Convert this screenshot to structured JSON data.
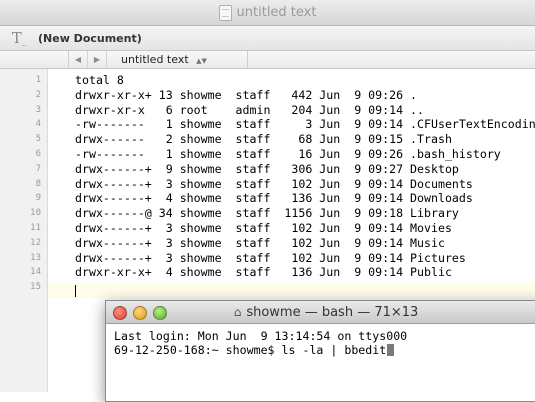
{
  "window": {
    "title": "untitled text"
  },
  "toolbar": {
    "document_name": "(New Document)"
  },
  "nav": {
    "prev_glyph": "◀",
    "next_glyph": "▶",
    "current_document": "untitled text",
    "doc_menu_glyph": "▲▼"
  },
  "editor": {
    "lines": [
      "total 8",
      "drwxr-xr-x+ 13 showme  staff   442 Jun  9 09:26 .",
      "drwxr-xr-x   6 root    admin   204 Jun  9 09:14 ..",
      "-rw-------   1 showme  staff     3 Jun  9 09:14 .CFUserTextEncoding",
      "drwx------   2 showme  staff    68 Jun  9 09:15 .Trash",
      "-rw-------   1 showme  staff    16 Jun  9 09:26 .bash_history",
      "drwx------+  9 showme  staff   306 Jun  9 09:27 Desktop",
      "drwx------+  3 showme  staff   102 Jun  9 09:14 Documents",
      "drwx------+  4 showme  staff   136 Jun  9 09:14 Downloads",
      "drwx------@ 34 showme  staff  1156 Jun  9 09:18 Library",
      "drwx------+  3 showme  staff   102 Jun  9 09:14 Movies",
      "drwx------+  3 showme  staff   102 Jun  9 09:14 Music",
      "drwx------+  3 showme  staff   102 Jun  9 09:14 Pictures",
      "drwxr-xr-x+  4 showme  staff   136 Jun  9 09:14 Public",
      ""
    ],
    "line_numbers": [
      "1",
      "2",
      "3",
      "4",
      "5",
      "6",
      "7",
      "8",
      "9",
      "10",
      "11",
      "12",
      "13",
      "14",
      "15"
    ]
  },
  "terminal": {
    "title": "showme — bash — 71×13",
    "line1": "Last login: Mon Jun  9 13:14:54 on ttys000",
    "line2": "69-12-250-168:~ showme$ ls -la | bbedit"
  },
  "icons": {
    "document": "document-icon",
    "text_tool": "text-tool-icon",
    "home": "home-icon"
  },
  "colors": {
    "close": "#d6402f",
    "minimize": "#d99a15",
    "maximize": "#5aa827",
    "cursor_line": "#fffde8"
  }
}
